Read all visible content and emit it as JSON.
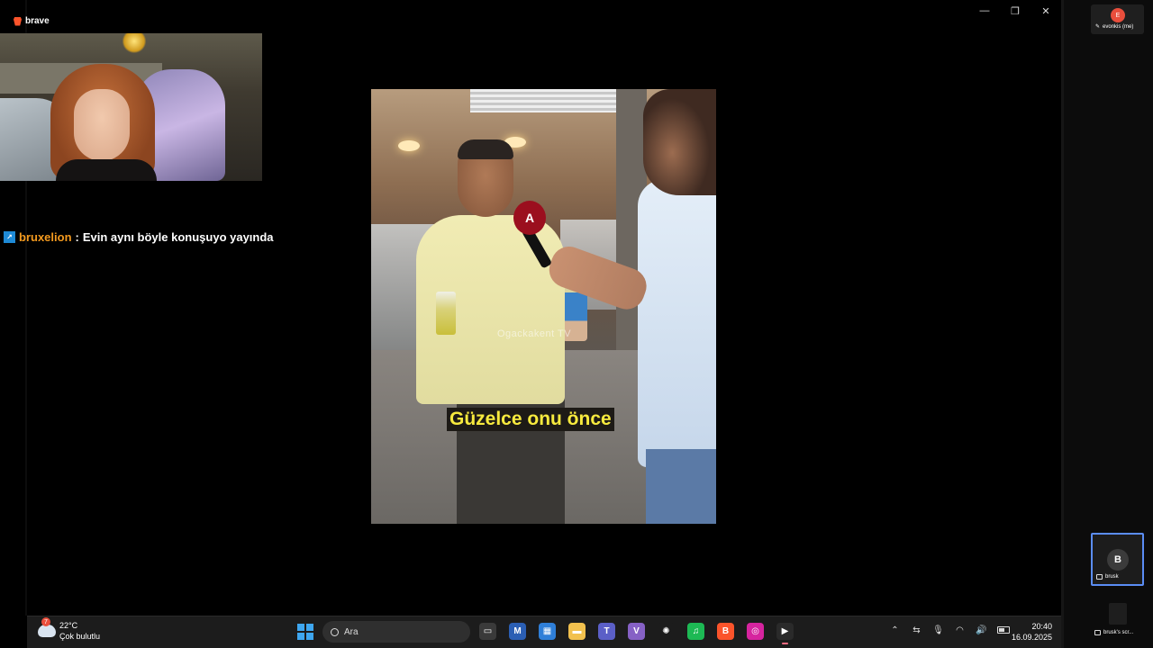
{
  "browser": {
    "name": "brave"
  },
  "window": {
    "minimize": "—",
    "restore": "❐",
    "close": "✕"
  },
  "chat": {
    "user": "bruxelion",
    "separator": ":",
    "message": "Evin aynı böyle konuşuyo yayında"
  },
  "video": {
    "watermark": "Ogackakent TV",
    "mic_logo": "A",
    "subtitle": "Güzelce onu önce"
  },
  "participants": [
    {
      "initial": "E",
      "name": "evonkis (me)",
      "color": "#e94e3c"
    },
    {
      "initial": "B",
      "name": "brusk"
    },
    {
      "name": "brusk's scr..."
    }
  ],
  "taskbar": {
    "weather": {
      "alert": "7",
      "temp": "22°C",
      "condition": "Çok bulutlu"
    },
    "search_placeholder": "Ara",
    "apps": [
      {
        "name": "task-view",
        "glyph": "▭",
        "color": "#3a3a3a"
      },
      {
        "name": "word-mail",
        "glyph": "M",
        "color": "#2b5fb4"
      },
      {
        "name": "store",
        "glyph": "▦",
        "color": "#2f7fd8"
      },
      {
        "name": "file-explorer",
        "glyph": "▬",
        "color": "#f2c14e"
      },
      {
        "name": "teams",
        "glyph": "T",
        "color": "#5b5fc7"
      },
      {
        "name": "visual-studio",
        "glyph": "V",
        "color": "#8661c5"
      },
      {
        "name": "chatgpt",
        "glyph": "✺",
        "color": "#1c1c1c"
      },
      {
        "name": "spotify",
        "glyph": "♫",
        "color": "#1db954"
      },
      {
        "name": "brave",
        "glyph": "B",
        "color": "#fb542b"
      },
      {
        "name": "instagram",
        "glyph": "◎",
        "color": "#d6249f"
      },
      {
        "name": "media-player",
        "glyph": "▶",
        "color": "#2a2a2a"
      }
    ],
    "tray": {
      "chevron": "⌃",
      "sliders": "⇆",
      "mic": "🎙",
      "wifi": "◠",
      "volume": "🔊"
    },
    "clock": {
      "time": "20:40",
      "date": "16.09.2025"
    }
  }
}
